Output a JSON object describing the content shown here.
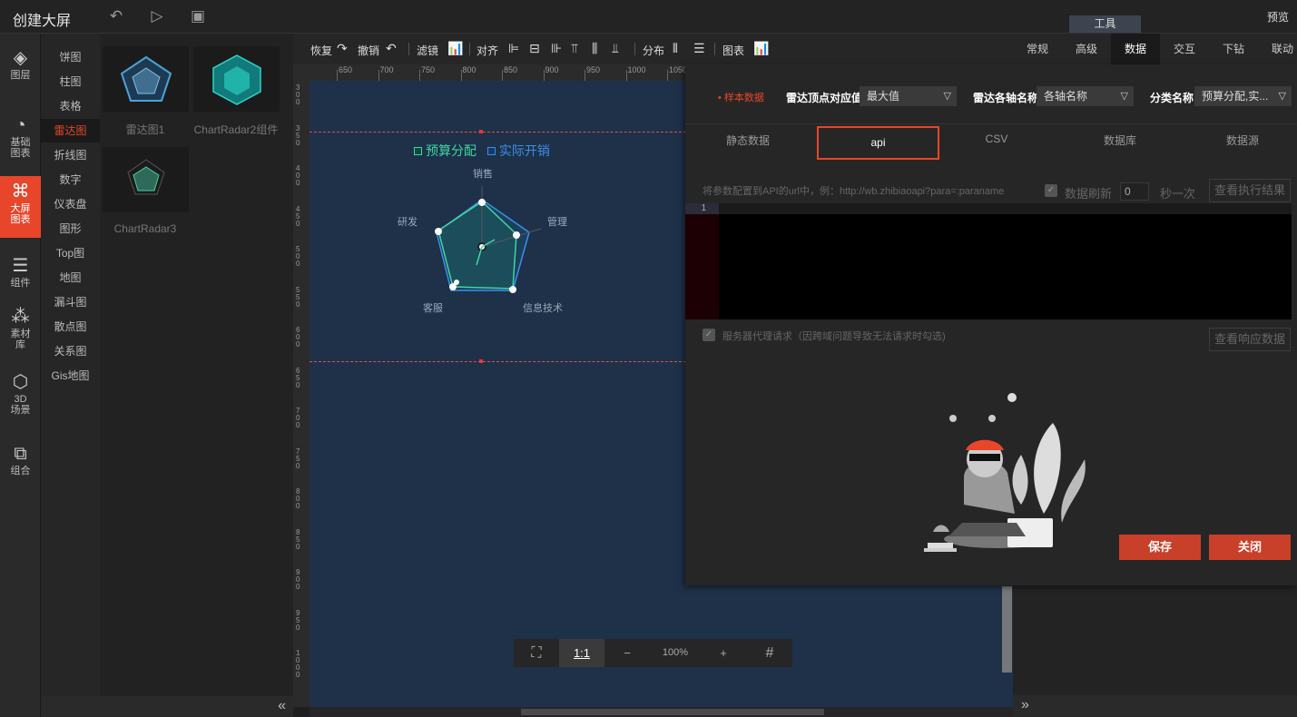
{
  "app": {
    "title": "创建大屏",
    "tools_tab": "工具",
    "preview": "预览"
  },
  "topbar_icons": [
    "undo-icon",
    "play-icon",
    "save-icon"
  ],
  "leftnav": [
    {
      "icon": "layers-icon",
      "glyph": "◈",
      "label": "图层"
    },
    {
      "icon": "chart-basic-icon",
      "glyph": "◔",
      "label": "基础\n图表"
    },
    {
      "icon": "big-screen-chart-icon",
      "glyph": "⌘",
      "label": "大屏\n图表",
      "active": true
    },
    {
      "icon": "component-icon",
      "glyph": "☰",
      "label": "组件"
    },
    {
      "icon": "material-icon",
      "glyph": "⁂",
      "label": "素材\n库"
    },
    {
      "icon": "cube-3d-icon",
      "glyph": "⬡",
      "label": "3D\n场景"
    },
    {
      "icon": "group-icon",
      "glyph": "⧉",
      "label": "组合"
    }
  ],
  "categories": [
    "饼图",
    "柱图",
    "表格",
    "雷达图",
    "折线图",
    "数字",
    "仪表盘",
    "图形",
    "Top图",
    "地图",
    "漏斗图",
    "散点图",
    "关系图",
    "Gis地图"
  ],
  "active_category": "雷达图",
  "thumbnails": [
    "雷达图1",
    "ChartRadar2组件",
    "ChartRadar3"
  ],
  "toolbar": {
    "redo": "恢复",
    "undo": "撤销",
    "filter": "滤镜",
    "align": "对齐",
    "distribute": "分布",
    "chart": "图表"
  },
  "ruler_h": [
    "650",
    "700",
    "750",
    "800",
    "850",
    "900",
    "950",
    "1000",
    "1050"
  ],
  "ruler_v": [
    "300",
    "350",
    "400",
    "450",
    "500",
    "550",
    "600",
    "650",
    "700",
    "750",
    "800",
    "850",
    "900",
    "950",
    "1000"
  ],
  "zoom": {
    "fit": "⛶",
    "one_to_one": "1:1",
    "minus": "−",
    "level": "100%",
    "plus": "+",
    "grid": "#"
  },
  "prop_tabs": [
    "常规",
    "高级",
    "数据",
    "交互",
    "下钻",
    "联动"
  ],
  "active_prop_tab": "数据",
  "data_panel": {
    "sample_label": "• 样本数据",
    "vertex_label": "雷达顶点对应值",
    "vertex_value": "最大值",
    "axis_label": "雷达各轴名称",
    "axis_value": "各轴名称",
    "category_label": "分类名称",
    "category_value": "预算分配,实...",
    "tabs": [
      "静态数据",
      "api",
      "CSV",
      "数据库",
      "数据源"
    ],
    "active_tab": "api",
    "hint": "将参数配置到API的url中，例：http://wb.zhibiaoapi?para=:paraname",
    "refresh_label": "数据刷新",
    "refresh_value": "0",
    "refresh_unit": "秒一次",
    "view_exec": "查看执行结果",
    "line_number": "1",
    "proxy_label": "服务器代理请求（因跨域问题导致无法请求时勾选)",
    "view_response": "查看响应数据",
    "save": "保存",
    "close": "关闭"
  },
  "chart_data": {
    "type": "radar",
    "legend": [
      "预算分配",
      "实际开销"
    ],
    "indicators": [
      "销售",
      "管理",
      "信息技术",
      "客服",
      "研发"
    ],
    "colors": {
      "budget": "#3fd6a5",
      "actual": "#3b8ee8"
    }
  }
}
